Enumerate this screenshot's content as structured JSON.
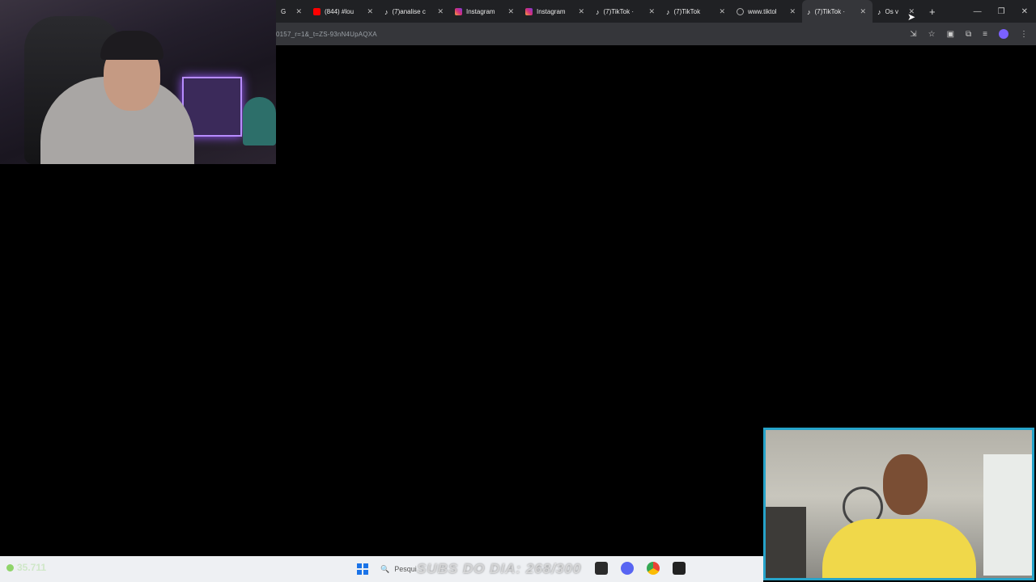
{
  "browser": {
    "tabs": [
      {
        "label": "G",
        "favicon": "generic",
        "active": false
      },
      {
        "label": "(844) #lou",
        "favicon": "youtube-icon",
        "active": false
      },
      {
        "label": "(7)analise c",
        "favicon": "tiktok-icon",
        "active": false
      },
      {
        "label": "Instagram",
        "favicon": "instagram-icon",
        "active": false
      },
      {
        "label": "Instagram",
        "favicon": "instagram-icon",
        "active": false
      },
      {
        "label": "(7)TikTok ·",
        "favicon": "tiktok-icon",
        "active": false
      },
      {
        "label": "(7)TikTok",
        "favicon": "tiktok-icon",
        "active": false
      },
      {
        "label": "www.tiktol",
        "favicon": "globe-icon",
        "active": false
      },
      {
        "label": "(7)TikTok ·",
        "favicon": "tiktok-icon",
        "active": true
      },
      {
        "label": "Os v",
        "favicon": "tiktok-icon",
        "active": false
      }
    ],
    "new_tab_symbol": "+",
    "url": "0157_r=1&_t=ZS-93nN4UpAQXA",
    "window_controls": {
      "minimize": "—",
      "restore": "❐",
      "close": "✕"
    }
  },
  "overlay": {
    "subscriber_count": "35.711",
    "banner_text": "SUBS DO DIA: 268/300"
  },
  "taskbar": {
    "search_placeholder": "Pesqui"
  },
  "colors": {
    "webcam_border": "#26a3c9",
    "tab_bar": "#202124",
    "active_tab": "#35363a",
    "taskbar": "#eef0f3"
  }
}
